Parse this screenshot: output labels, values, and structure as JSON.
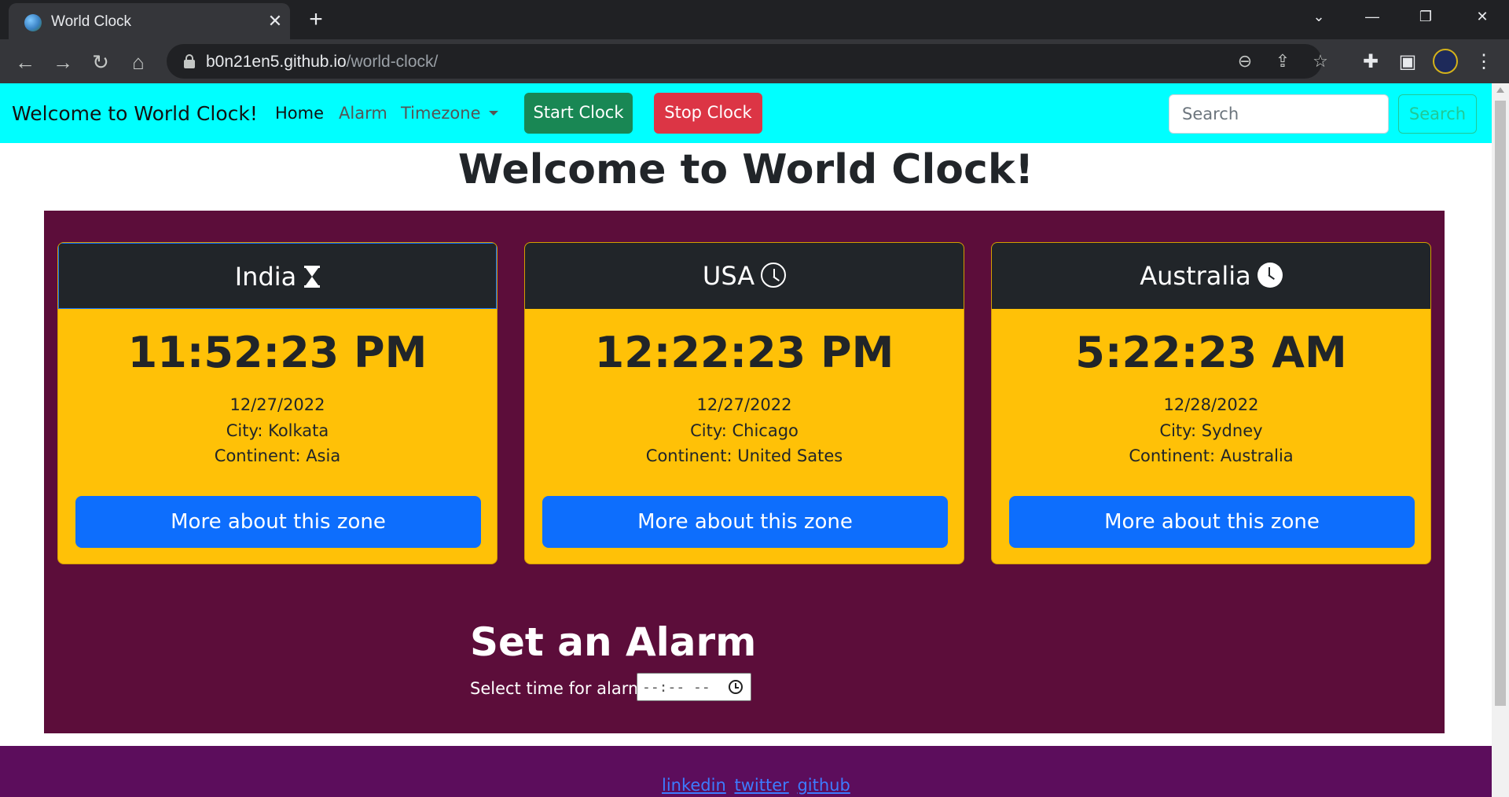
{
  "browser": {
    "tab_title": "World Clock",
    "url_host": "b0n21en5.github.io",
    "url_path": "/world-clock/"
  },
  "navbar": {
    "brand": "Welcome to World Clock!",
    "links": [
      "Home",
      "Alarm",
      "Timezone"
    ],
    "start_label": "Start Clock",
    "stop_label": "Stop Clock",
    "search_placeholder": "Search",
    "search_button": "Search"
  },
  "hero_title": "Welcome to World Clock!",
  "clocks": [
    {
      "country": "India",
      "icon": "hourglass-icon",
      "time": "11:52:23 PM",
      "date": "12/27/2022",
      "city": "City: Kolkata",
      "continent": "Continent: Asia",
      "button": "More about this zone"
    },
    {
      "country": "USA",
      "icon": "clock-outline-icon",
      "time": "12:22:23 PM",
      "date": "12/27/2022",
      "city": "City: Chicago",
      "continent": "Continent: United Sates",
      "button": "More about this zone"
    },
    {
      "country": "Australia",
      "icon": "clock-filled-icon",
      "time": "5:22:23 AM",
      "date": "12/28/2022",
      "city": "City: Sydney",
      "continent": "Continent: Australia",
      "button": "More about this zone"
    }
  ],
  "alarm": {
    "title": "Set an Alarm",
    "label": "Select time for alarm:",
    "time_placeholder": "--:-- --"
  },
  "footer": {
    "links": [
      "linkedin",
      "twitter",
      "github"
    ]
  },
  "colors": {
    "navbar": "#00ffff",
    "band": "#5c0d3a",
    "card": "#ffc107",
    "start_btn": "#198754",
    "stop_btn": "#dc3545",
    "more_btn": "#0d6efd",
    "footer": "#5c0d5c"
  }
}
